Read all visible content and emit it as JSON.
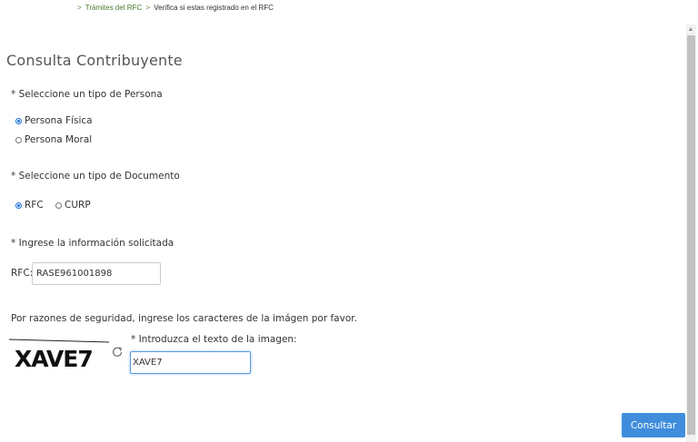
{
  "breadcrumb": {
    "separator": ">",
    "items": [
      "Trámites del RFC",
      "Verifica si estas registrado en el RFC"
    ]
  },
  "page": {
    "title": "Consulta Contribuyente"
  },
  "persona_section": {
    "label": "* Seleccione un tipo de Persona",
    "options": [
      {
        "label": "Persona Física",
        "selected": true
      },
      {
        "label": "Persona Moral",
        "selected": false
      }
    ]
  },
  "documento_section": {
    "label": "* Seleccione un tipo de Documento",
    "options": [
      {
        "label": "RFC",
        "selected": true
      },
      {
        "label": "CURP",
        "selected": false
      }
    ]
  },
  "info_section": {
    "label": "* Ingrese la información solicitada",
    "rfc_label": "RFC:",
    "rfc_value": "RASE961001898"
  },
  "security": {
    "text": "Por razones de seguridad, ingrese los caracteres de la imágen por favor.",
    "captcha_text": "XAVE7",
    "captcha_label": "* Introduzca el texto de la imagen:",
    "captcha_value": "XAVE7"
  },
  "actions": {
    "submit_label": "Consultar"
  },
  "colors": {
    "accent": "#3f8ddc",
    "breadcrumb_link": "#4a7a2e",
    "radio_selected": "#1a6fd6"
  }
}
